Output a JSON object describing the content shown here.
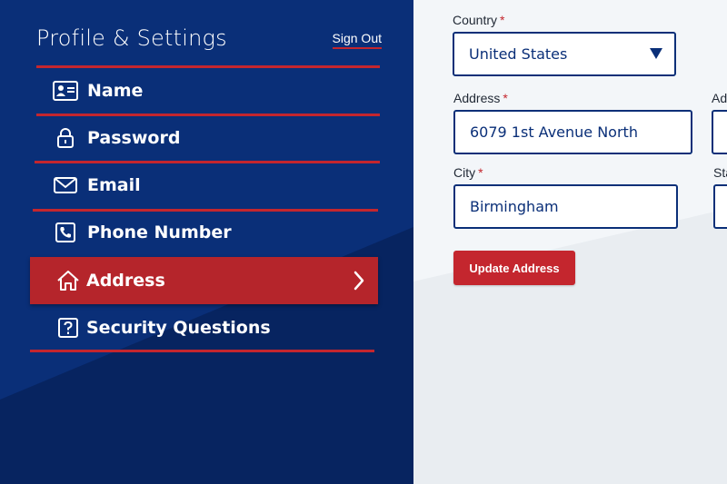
{
  "sidebar": {
    "title": "Profile & Settings",
    "sign_out": "Sign Out",
    "items": [
      {
        "label": "Name",
        "icon": "id-card-icon"
      },
      {
        "label": "Password",
        "icon": "lock-icon"
      },
      {
        "label": "Email",
        "icon": "envelope-icon"
      },
      {
        "label": "Phone Number",
        "icon": "phone-icon"
      },
      {
        "label": "Address",
        "icon": "home-icon",
        "active": true
      },
      {
        "label": "Security Questions",
        "icon": "question-icon"
      }
    ]
  },
  "form": {
    "country": {
      "label": "Country",
      "required_mark": "*",
      "value": "United States"
    },
    "address": {
      "label": "Address",
      "required_mark": "*",
      "value": "6079 1st Avenue North"
    },
    "address2": {
      "label": "Add"
    },
    "city": {
      "label": "City",
      "required_mark": "*",
      "value": "Birmingham"
    },
    "state": {
      "label": "Sta"
    },
    "submit_label": "Update Address"
  },
  "colors": {
    "navy": "#0a2f78",
    "red": "#c4262e",
    "background": "#f0f3f7"
  }
}
